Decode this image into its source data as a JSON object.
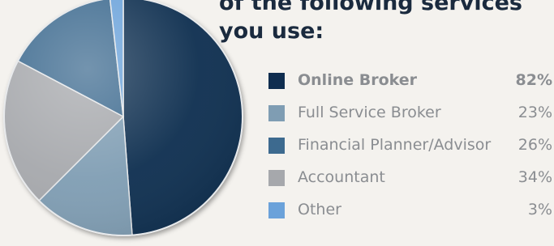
{
  "heading_lines": [
    "of the following services",
    "you use:"
  ],
  "chart_data": {
    "type": "pie",
    "title": "",
    "series": [
      {
        "name": "Online Broker",
        "display": "82%",
        "value": 82,
        "color": "#0f2d4f",
        "emphasis": true
      },
      {
        "name": "Full Service Broker",
        "display": "23%",
        "value": 23,
        "color": "#7f9db3",
        "emphasis": false
      },
      {
        "name": "Financial Planner/Advisor",
        "display": "26%",
        "value": 26,
        "color": "#3d6a8f",
        "emphasis": false
      },
      {
        "name": "Accountant",
        "display": "34%",
        "value": 34,
        "color": "#a6a8ac",
        "emphasis": false
      },
      {
        "name": "Other",
        "display": "3%",
        "value": 3,
        "color": "#6ba2da",
        "emphasis": false
      }
    ],
    "legend": "right",
    "pie_order": [
      "Online Broker",
      "Full Service Broker",
      "Accountant",
      "Financial Planner/Advisor",
      "Other"
    ]
  }
}
